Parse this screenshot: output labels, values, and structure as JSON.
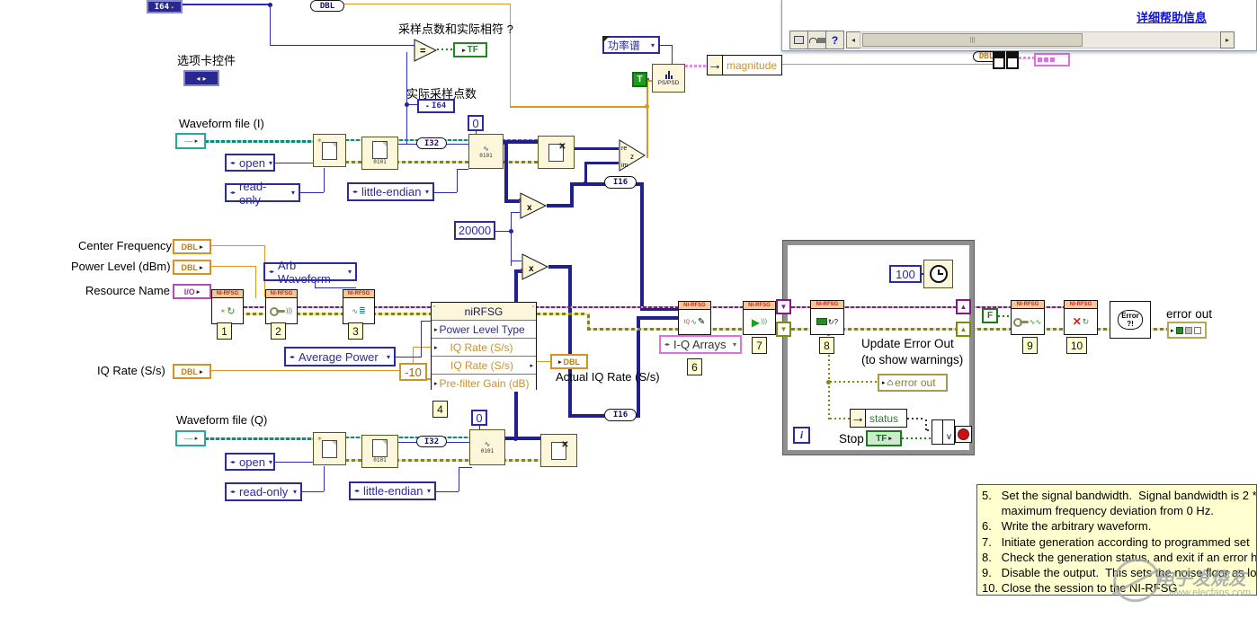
{
  "window": {
    "help_link": "详细帮助信息",
    "help_glyph": "?"
  },
  "annotations": {
    "samples_match": "采样点数和实际相符 ?",
    "tab_control": "选项卡控件",
    "actual_samples": "实际采样点数",
    "waveform_i": "Waveform file (I)",
    "waveform_q": "Waveform file (Q)",
    "center_frequency": "Center Frequency (Hz)",
    "power_level": "Power Level (dBm)",
    "resource_name": "Resource Name",
    "iq_rate": "IQ Rate (S/s)",
    "actual_iq_rate": "Actual IQ Rate (S/s)",
    "update_error_1": "Update Error Out",
    "update_error_2": "(to show warnings)",
    "stop": "Stop",
    "error_out": "error out"
  },
  "type_tags": {
    "i64": "I64",
    "dbl": "DBL",
    "i32": "I32",
    "i16": "I16",
    "io": "I/O",
    "tf": "TF"
  },
  "enums": {
    "open": "open",
    "read_only": "read-only",
    "little_endian": "little-endian",
    "arb_waveform": "Arb Waveform",
    "average_power": "Average Power",
    "iq_arrays": "I-Q Arrays",
    "power_spectrum": "功率谱"
  },
  "constants": {
    "zero": "0",
    "c20000": "20000",
    "c100": "100",
    "neg10": "-10",
    "t": "T",
    "f": "F"
  },
  "rfsg": {
    "header": "NI-RFSG",
    "numbers": [
      "1",
      "2",
      "3",
      "4",
      "6",
      "7",
      "8",
      "9",
      "10"
    ]
  },
  "property_node": {
    "title": "niRFSG",
    "rows": [
      "Power Level Type",
      "IQ Rate (S/s)",
      "IQ Rate (S/s)",
      "Pre-filter Gain (dB)"
    ]
  },
  "nodes": {
    "ps_psd": "PS/PSD",
    "magnitude": "magnitude",
    "status": "status",
    "error_local": "error out",
    "error_dialog": "Error\n?!",
    "iteration": "i",
    "or": "v",
    "bin": "0101",
    "multiply": "x",
    "equal": "="
  },
  "comment": {
    "lines": [
      "5.   Set the signal bandwidth.  Signal bandwidth is 2 *",
      "      maximum frequency deviation from 0 Hz.",
      "6.   Write the arbitrary waveform.",
      "7.   Initiate generation according to programmed set",
      "8.   Check the generation status, and exit if an error h",
      "9.   Disable the output.  This sets the noise floor as lo",
      "10. Close the session to the NI-RFSG"
    ]
  },
  "watermark": {
    "name": "电子发烧友",
    "site": "www.elecfans.com"
  },
  "colors": {
    "wire_orange": "#e0951e",
    "wire_blue": "#20208c",
    "error_olive": "#86860e",
    "session_purple": "#8a148a",
    "path_teal": "#0f8a77",
    "boolean_green": "#1f8a1f",
    "pink": "#e06ee0",
    "link_blue": "#1010c8",
    "comment_bg": "#ffffd0"
  }
}
